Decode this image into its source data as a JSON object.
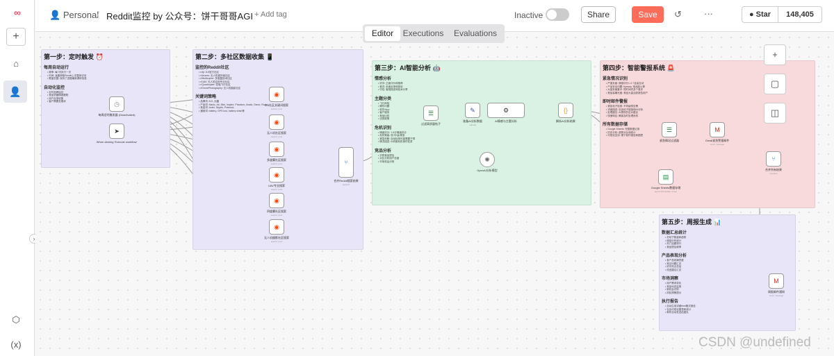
{
  "header": {
    "project": "Personal",
    "title": "Reddit监控 by 公众号：饼干哥哥AGI",
    "add_tag": "+ Add tag",
    "status": "Inactive",
    "share": "Share",
    "save": "Save",
    "star": "Star",
    "star_count": "148,405"
  },
  "tabs": [
    "Editor",
    "Executions",
    "Evaluations"
  ],
  "stickies": [
    {
      "title": "第一步：定时触发 ⏰",
      "color": "#e7e5f7",
      "sections": [
        {
          "h": "每周自动运行",
          "lines": [
            "• 频率: 每7天执行一次",
            "• 时间: 凌晨获取Reddit上次整体访问",
            "• 覆盖范围: 保持了进展最新调研信息"
          ]
        },
        {
          "h": "自动化监控",
          "lines": [
            "• 定时品牌监控",
            "• 竞品机器情报跟踪",
            "• 用户反馈收集",
            "• 客户需要发展状"
          ]
        }
      ]
    },
    {
      "title": "第二步：多社区数据收集 📱",
      "color": "#e7e5f7",
      "sections": [
        {
          "h": "监控的Reddit社区",
          "lines": [
            "• r/dji: DJI官方社区",
            "• r/drones: 无人机爱好者社区",
            "• r/Multicopter: 多旋翼技术社区",
            "• r/UAV: 无人机应用专业社区",
            "• r/Quadcopter: 四轴飞行社区",
            "• r/DronePhotography: 无人机摄影社区"
          ]
        },
        {
          "h": "关键词策略",
          "lines": [
            "• 品牌词: DJI, 大疆",
            "• 产品词: Mavic, Air, Mini, Inspire, Phantom, Avata, Osmo, Ronin",
            "• 竞品词: Autel, Skydio, Potensic",
            "• 通用词: battery, GPS lost, battery drain等"
          ]
        }
      ]
    },
    {
      "title": "第三步：AI智能分析 🤖",
      "color": "#d9f2e3",
      "sections": [
        {
          "h": "情感分析",
          "lines": [
            "• 好评: 正面评价和推荐",
            "• 差评: 负面反馈和投诉",
            "• 中性: 客观描述和技术分享"
          ]
        },
        {
          "h": "主题分类",
          "lines": [
            "• 飞行体验",
            "• 硬件问题",
            "• 软件/App",
            "• 客户服务",
            "• 竞品比较",
            "• 法规政策"
          ]
        },
        {
          "h": "危机识别",
          "lines": [
            "• 情绪评分: 1-5分情绪评分",
            "• 危机等级: 低/中/高/紧急",
            "• 紧急判断: 自动检测可能需要干预",
            "• 情况描述: AI判断危机事件性质"
          ]
        },
        {
          "h": "竞品分析",
          "lines": [
            "• 识别竞品提及",
            "• 对比分析用户态度",
            "• 市场机会识别"
          ]
        }
      ]
    },
    {
      "title": "第四步：智能警报系统 🚨",
      "color": "#f8dadd",
      "sections": [
        {
          "h": "紧急情况识别",
          "lines": [
            "• 严重负面: 情感评分<-0.7且高互动",
            "• 产品安全问题: flyaway, 电池起火等",
            "• 大量负面集中: 短时间内多个差评",
            "• 竞品高曝光度: 竞品大量活跃报告用户"
          ]
        },
        {
          "h": "即时邮件警报",
          "lines": [
            "• 紧急帖子检测: 不同级别告警",
            "• 详细描述: 包含帖子链接和AI分析",
            "• 处理建议: AI提供的应对建议",
            "• 快速响应: 确保及时处理危机"
          ]
        },
        {
          "h": "所有数据存储",
          "lines": [
            "• Google Sheets: 完整数据记录",
            "• 历史分析: 趋势对比和统计",
            "• 可视化支持: 便于制作报告和图表"
          ]
        }
      ]
    },
    {
      "title": "第五步：周报生成 📊",
      "color": "#e7e5f7",
      "sections": [
        {
          "h": "数据汇总统计",
          "lines": [
            "• 总帖子数量和趋势",
            "• 情感分布统计",
            "• 热门话题排行",
            "• 竞品提及频率"
          ]
        },
        {
          "h": "产品表现分析",
          "lines": [
            "• 各产品线满意度",
            "• 常见问题汇总",
            "• 好评亮点总结",
            "• 改进建议汇总"
          ]
        },
        {
          "h": "市场洞察",
          "lines": [
            "• 用户需求变化",
            "• 竞品动态监测",
            "• 新机会识别",
            "• 风险预警提示"
          ]
        },
        {
          "h": "执行报告",
          "lines": [
            "• 自动生成详细html格式报告",
            "• 包含可视化图表和统计",
            "• 邮件自动发送给团队"
          ]
        }
      ]
    }
  ],
  "nodes": [
    {
      "icon": "clock-icon",
      "glyph": "◷",
      "label": "每周定时触发器\n(Deactivated)",
      "sub": "",
      "color": "#888"
    },
    {
      "icon": "cursor-icon",
      "glyph": "➤",
      "label": "When clicking 'Execute workflow'",
      "sub": "",
      "color": "#333"
    },
    {
      "icon": "reddit-icon",
      "glyph": "◉",
      "label": "DJI社区关键词搜索",
      "sub": "search: post",
      "color": "#ff4500"
    },
    {
      "icon": "reddit-icon",
      "glyph": "◉",
      "label": "无人机社区搜索",
      "sub": "search: post",
      "color": "#ff4500"
    },
    {
      "icon": "reddit-icon",
      "glyph": "◉",
      "label": "多旋翼社区搜索",
      "sub": "search: post",
      "color": "#ff4500"
    },
    {
      "icon": "reddit-icon",
      "glyph": "◉",
      "label": "UAV专业搜索",
      "sub": "search: post",
      "color": "#ff4500"
    },
    {
      "icon": "reddit-icon",
      "glyph": "◉",
      "label": "四旋翼社区搜索",
      "sub": "search: post",
      "color": "#ff4500"
    },
    {
      "icon": "reddit-icon",
      "glyph": "◉",
      "label": "无人机摄影社区搜索",
      "sub": "search: post",
      "color": "#ff4500"
    },
    {
      "icon": "merge-icon",
      "glyph": "⑂",
      "label": "合并Reddit搜索结果",
      "sub": "append",
      "color": "#3a7bd5"
    },
    {
      "icon": "filter-icon",
      "glyph": "☰",
      "label": "过滤高质量帖子",
      "sub": "",
      "color": "#2c7a3c"
    },
    {
      "icon": "pen-icon",
      "glyph": "✎",
      "label": "准备AI分析数据",
      "sub": "manual",
      "color": "#3355aa"
    },
    {
      "icon": "robot-icon",
      "glyph": "⚙",
      "label": "AI情感与主题分析",
      "sub": "",
      "color": "#333"
    },
    {
      "icon": "code-icon",
      "glyph": "{}",
      "label": "解析AI分析结果",
      "sub": "",
      "color": "#e8a33a"
    },
    {
      "icon": "openai-icon",
      "glyph": "✺",
      "label": "OpenAI分析模型",
      "sub": "",
      "color": "#666"
    },
    {
      "icon": "filter-icon",
      "glyph": "☰",
      "label": "紧急情况过滤器",
      "sub": "",
      "color": "#2c7a3c"
    },
    {
      "icon": "gmail-icon",
      "glyph": "M",
      "label": "Gmail紧急警报邮件",
      "sub": "send: message",
      "color": "#d93025"
    },
    {
      "icon": "sheets-icon",
      "glyph": "▤",
      "label": "Google Sheets数据存储",
      "sub": "appendOrUpdate: sheet",
      "color": "#1e8e3e"
    },
    {
      "icon": "merge-icon",
      "glyph": "⑂",
      "label": "合并所有结果",
      "sub": "combine",
      "color": "#3a7bd5"
    },
    {
      "icon": "gmail-icon",
      "glyph": "M",
      "label": "周报邮件通知",
      "sub": "send: message",
      "color": "#d93025"
    }
  ],
  "canvas_controls": [
    "+",
    "▢",
    "◫"
  ],
  "watermark": "CSDN @undefined"
}
